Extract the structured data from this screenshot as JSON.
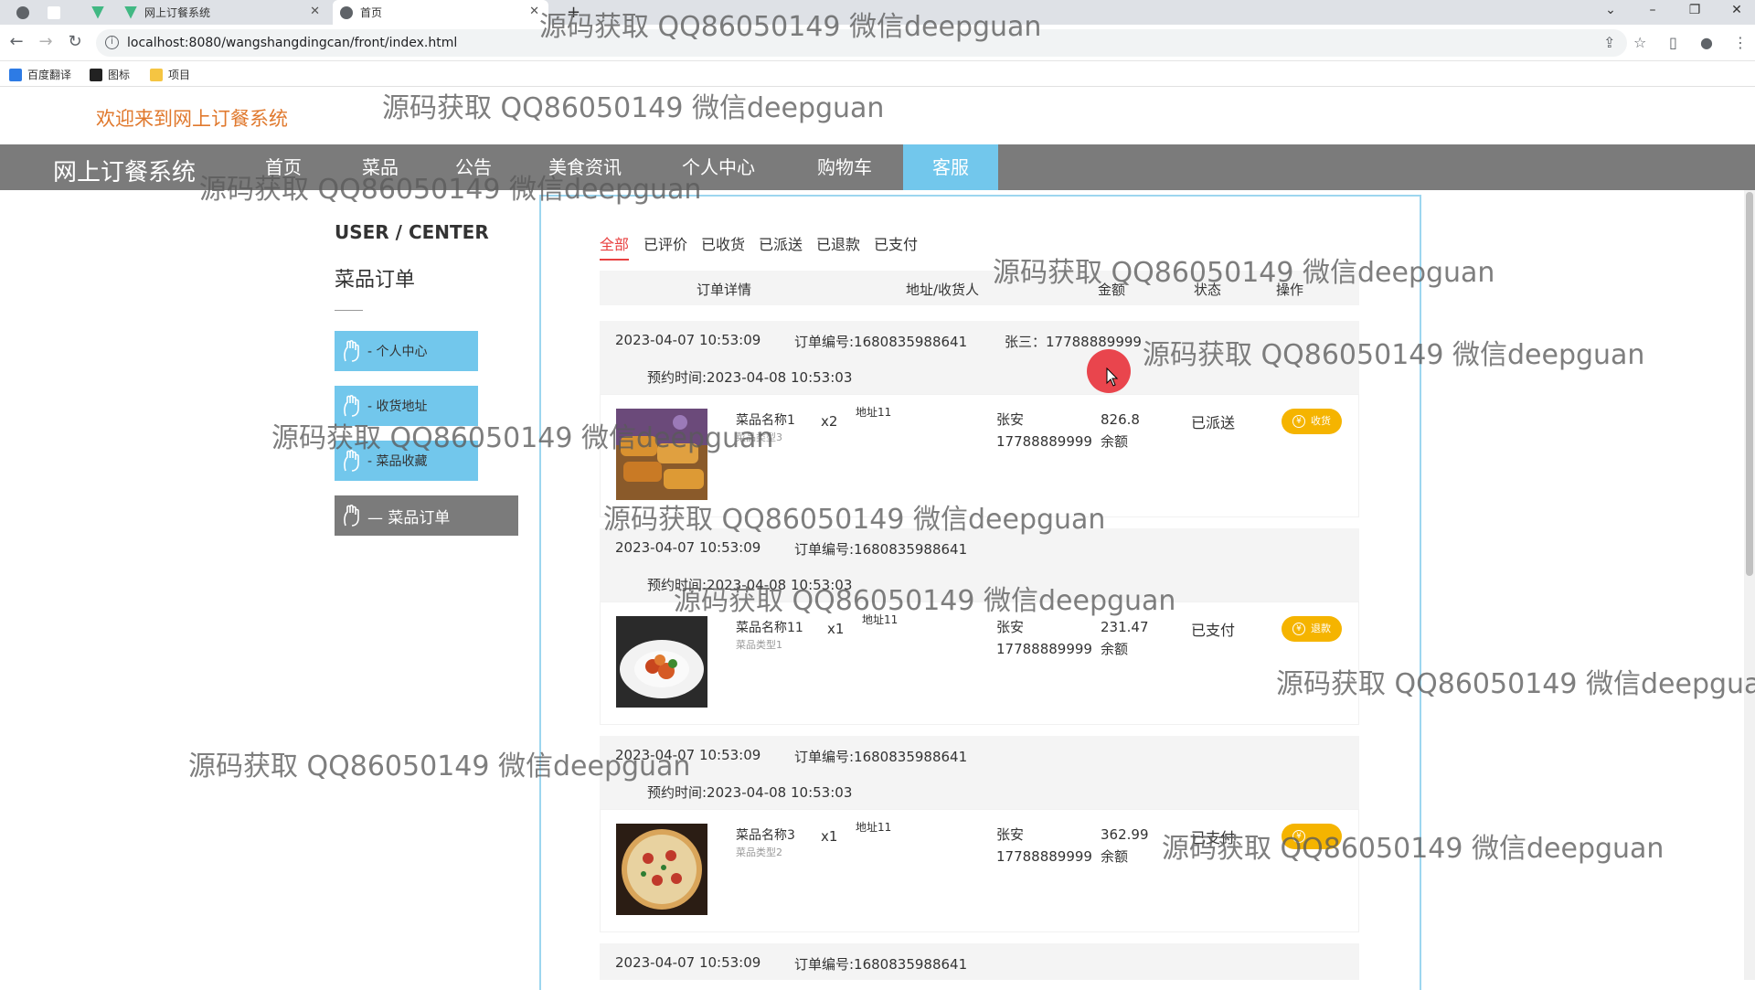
{
  "browser": {
    "tabs": [
      {
        "title": ""
      },
      {
        "title": "网上订餐系统"
      },
      {
        "title": "首页"
      }
    ],
    "url": "localhost:8080/wangshangdingcan/front/index.html",
    "bookmarks": [
      "百度翻译",
      "图标",
      "项目"
    ]
  },
  "site": {
    "welcome": "欢迎来到网上订餐系统",
    "brand": "网上订餐系统",
    "nav": [
      "首页",
      "菜品",
      "公告",
      "美食资讯",
      "个人中心",
      "购物车",
      "客服"
    ],
    "active_nav": "客服"
  },
  "user_center": {
    "title": "USER / CENTER",
    "subtitle": "菜品订单",
    "menu": [
      {
        "label": "- 个人中心"
      },
      {
        "label": "- 收货地址"
      },
      {
        "label": "- 菜品收藏"
      },
      {
        "label": "— 菜品订单"
      }
    ]
  },
  "filters": [
    "全部",
    "已评价",
    "已收货",
    "已派送",
    "已退款",
    "已支付"
  ],
  "table_headers": [
    "订单详情",
    "地址/收货人",
    "金额",
    "状态",
    "操作"
  ],
  "orders": [
    {
      "date": "2023-04-07 10:53:09",
      "order_no": "订单编号:1680835988641",
      "contact": "张三：17788889999",
      "reserve": "预约时间:2023-04-08 10:53:03",
      "dish": "菜品名称1",
      "type": "菜品类型3",
      "qty": "x2",
      "address": "地址11",
      "receiver": "张安",
      "phone": "17788889999",
      "amount": "826.8",
      "pay": "余额",
      "status": "已派送",
      "action": "收货"
    },
    {
      "date": "2023-04-07 10:53:09",
      "order_no": "订单编号:1680835988641",
      "contact": "",
      "reserve": "预约时间:2023-04-08 10:53:03",
      "dish": "菜品名称11",
      "type": "菜品类型1",
      "qty": "x1",
      "address": "地址11",
      "receiver": "张安",
      "phone": "17788889999",
      "amount": "231.47",
      "pay": "余额",
      "status": "已支付",
      "action": "退款"
    },
    {
      "date": "2023-04-07 10:53:09",
      "order_no": "订单编号:1680835988641",
      "contact": "",
      "reserve": "预约时间:2023-04-08 10:53:03",
      "dish": "菜品名称3",
      "type": "菜品类型2",
      "qty": "x1",
      "address": "地址11",
      "receiver": "张安",
      "phone": "17788889999",
      "amount": "362.99",
      "pay": "余额",
      "status": "已支付",
      "action": ""
    },
    {
      "date": "2023-04-07 10:53:09",
      "order_no": "订单编号:1680835988641"
    }
  ],
  "watermark": "源码获取 QQ86050149 微信deepguan",
  "colors": {
    "nav_bg": "#7b7b7b",
    "accent": "#72c7ec",
    "welcome": "#e0792e",
    "action": "#f5b400",
    "filter_active": "#e84141"
  }
}
